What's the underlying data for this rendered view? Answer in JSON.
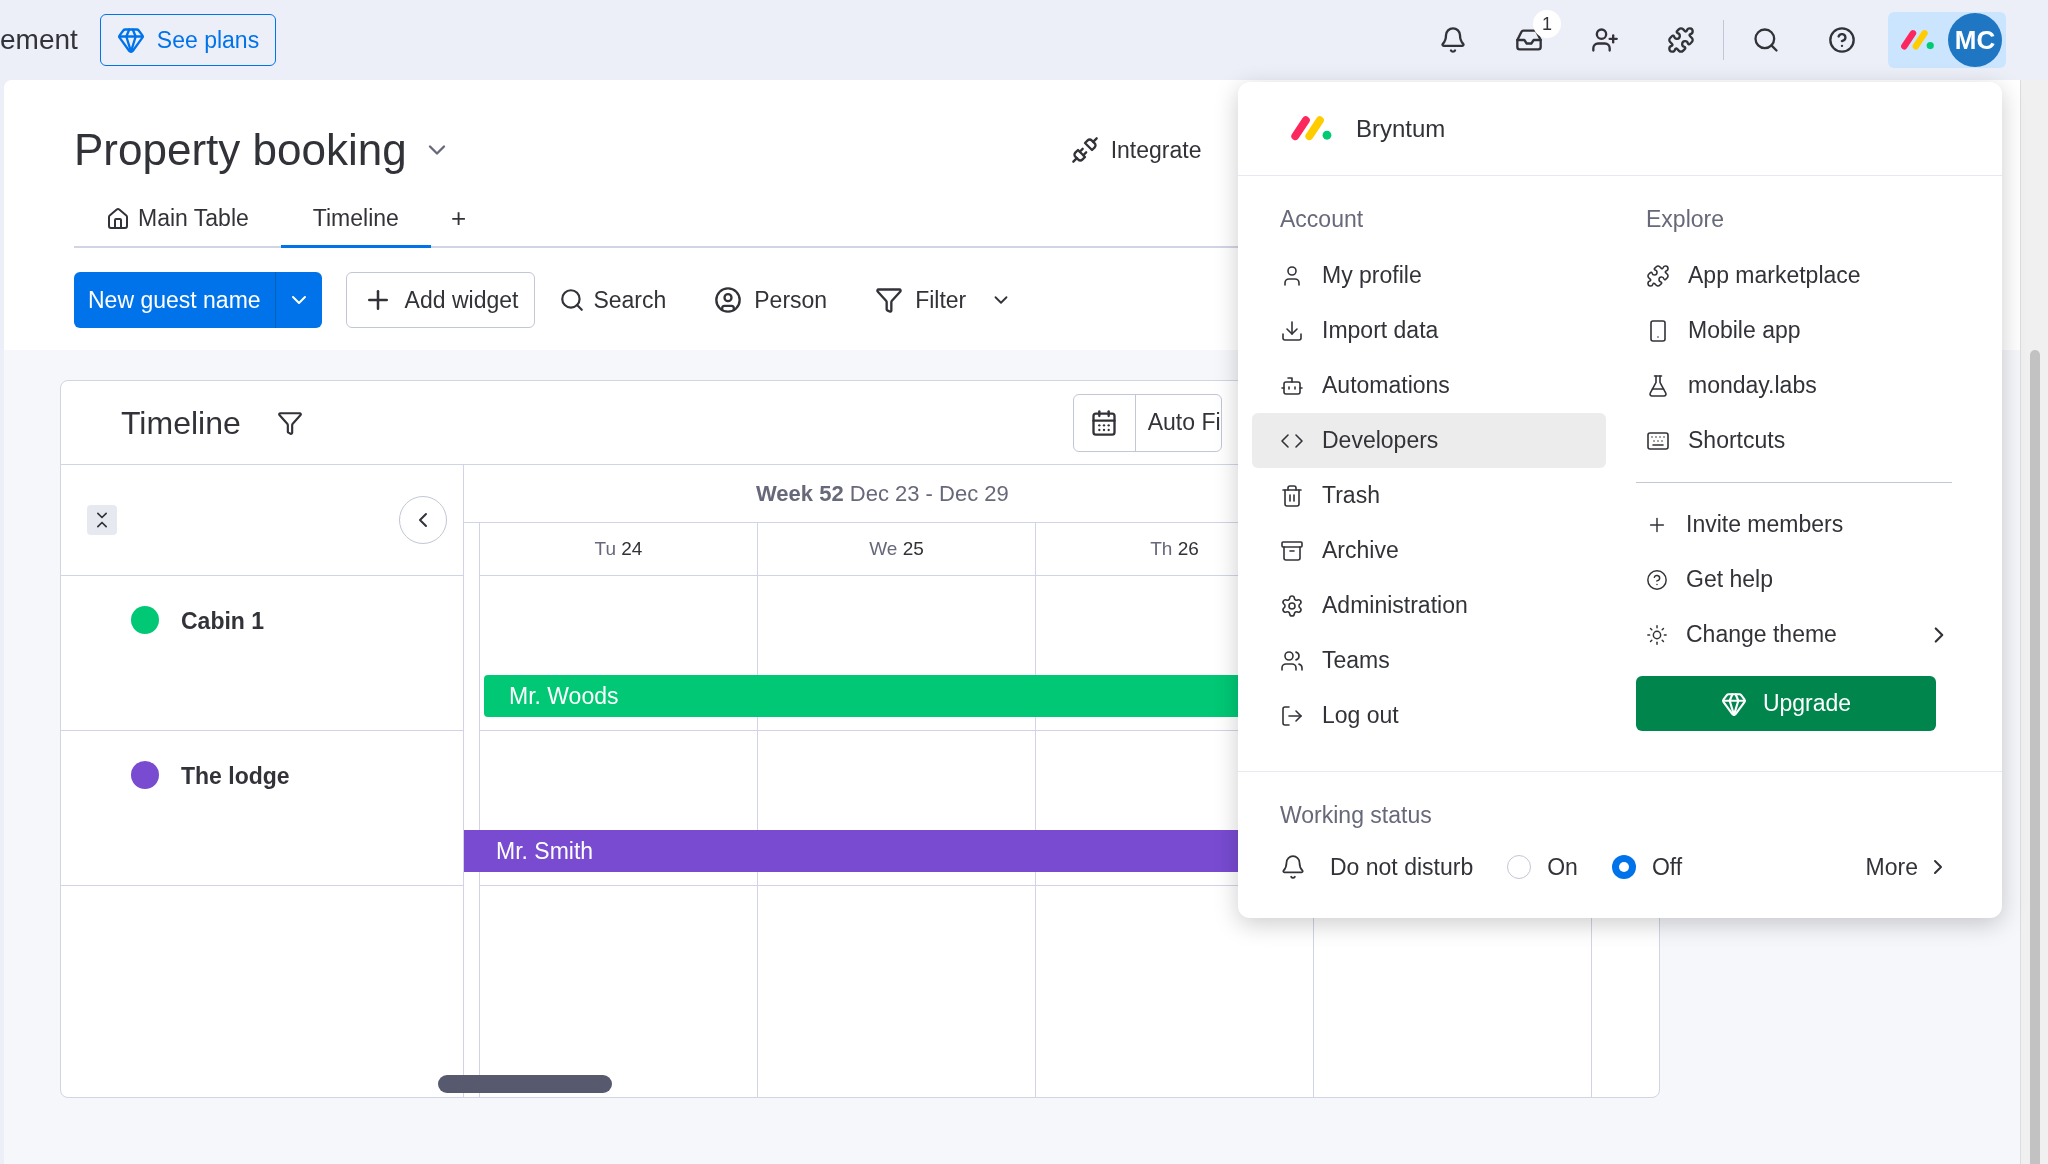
{
  "top_bar": {
    "title_fragment": "ement",
    "see_plans": "See plans",
    "inbox_badge": "1",
    "avatar_initials": "MC"
  },
  "board": {
    "title": "Property booking",
    "integrate": "Integrate",
    "tabs": [
      {
        "label": "Main Table",
        "selected": false,
        "kind": "home"
      },
      {
        "label": "Timeline",
        "selected": true,
        "kind": "plain"
      }
    ],
    "add_tab": "+"
  },
  "toolbar": {
    "primary_button": "New guest name",
    "add_widget": "Add widget",
    "search": "Search",
    "person": "Person",
    "filter": "Filter"
  },
  "timeline": {
    "title": "Timeline",
    "auto_fit": "Auto Fi",
    "week_label": "Week 52",
    "week_range": "Dec 23 - Dec 29",
    "days": [
      {
        "weekday": "Tu",
        "day": "24"
      },
      {
        "weekday": "We",
        "day": "25"
      },
      {
        "weekday": "Th",
        "day": "26"
      }
    ],
    "groups": [
      {
        "name": "Cabin 1",
        "color": "#00c875",
        "booking": "Mr. Woods"
      },
      {
        "name": "The lodge",
        "color": "#784bd1",
        "booking": "Mr. Smith"
      }
    ]
  },
  "menu": {
    "brand": "Bryntum",
    "account": {
      "heading": "Account",
      "items": [
        {
          "label": "My profile",
          "selected": false
        },
        {
          "label": "Import data",
          "selected": false
        },
        {
          "label": "Automations",
          "selected": false
        },
        {
          "label": "Developers",
          "selected": true
        },
        {
          "label": "Trash",
          "selected": false
        },
        {
          "label": "Archive",
          "selected": false
        },
        {
          "label": "Administration",
          "selected": false
        },
        {
          "label": "Teams",
          "selected": false
        },
        {
          "label": "Log out",
          "selected": false
        }
      ]
    },
    "explore": {
      "heading": "Explore",
      "items": [
        {
          "label": "App marketplace"
        },
        {
          "label": "Mobile app"
        },
        {
          "label": "monday.labs"
        },
        {
          "label": "Shortcuts"
        }
      ],
      "more_items": [
        {
          "label": "Invite members",
          "kind": "plain"
        },
        {
          "label": "Get help",
          "kind": "plain"
        },
        {
          "label": "Change theme",
          "kind": "submenu"
        }
      ]
    },
    "upgrade": "Upgrade",
    "working_status": {
      "heading": "Working status",
      "label": "Do not disturb",
      "options": [
        {
          "label": "On",
          "selected": false
        },
        {
          "label": "Off",
          "selected": true
        }
      ],
      "more": "More"
    }
  }
}
